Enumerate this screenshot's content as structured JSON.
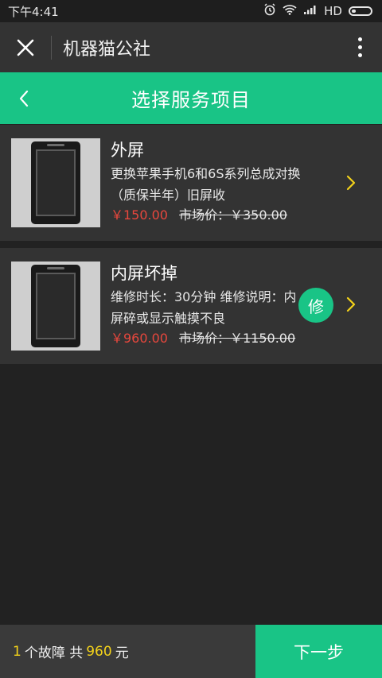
{
  "status_bar": {
    "time": "下午4:41",
    "network": "HD"
  },
  "app_bar": {
    "title": "机器猫公社"
  },
  "header": {
    "title": "选择服务项目"
  },
  "items": [
    {
      "title": "外屏",
      "desc": "更换苹果手机6和6S系列总成对换（质保半年）旧屏收",
      "price": "￥150.00",
      "market_price": "市场价：￥350.00"
    },
    {
      "title": "内屏坏掉",
      "desc": "维修时长：30分钟 维修说明：内屏碎或显示触摸不良",
      "price": "￥960.00",
      "market_price": "市场价：￥1150.00",
      "badge": "修"
    }
  ],
  "footer": {
    "count": "1",
    "count_unit": "个故障 共",
    "total": "960",
    "total_unit": "元",
    "next_label": "下一步"
  },
  "colors": {
    "accent": "#19c486",
    "price": "#e8473d",
    "highlight": "#f3d21a"
  }
}
